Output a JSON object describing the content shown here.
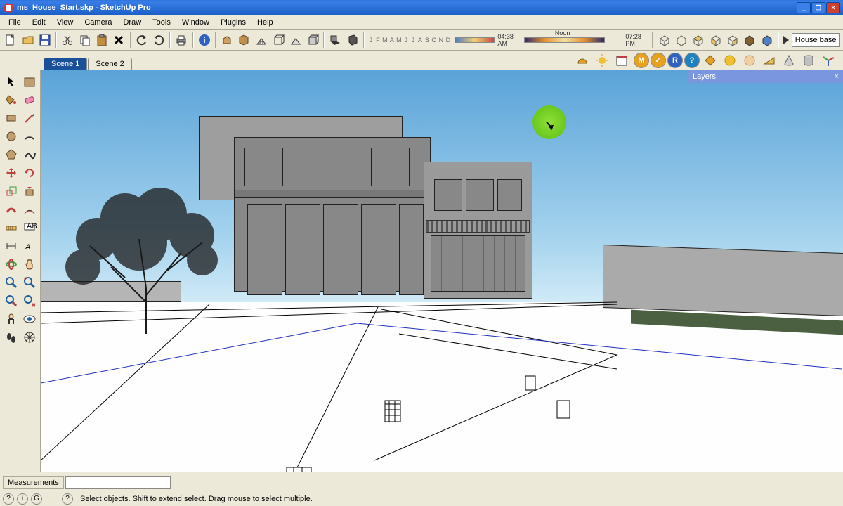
{
  "title": "ms_House_Start.skp - SketchUp Pro",
  "window_buttons": {
    "min": "_",
    "max": "❐",
    "close": "×"
  },
  "menu": [
    "File",
    "Edit",
    "View",
    "Camera",
    "Draw",
    "Tools",
    "Window",
    "Plugins",
    "Help"
  ],
  "main_toolbar_icons": [
    "new",
    "open",
    "save",
    "cut",
    "copy",
    "paste",
    "delete",
    "undo",
    "redo",
    "print",
    "info",
    "group",
    "component",
    "house-sm",
    "box-sm",
    "box-shaded",
    "box-wire",
    "cube-shadow",
    "cube-solid"
  ],
  "shadow": {
    "months": [
      "J",
      "F",
      "M",
      "A",
      "M",
      "J",
      "J",
      "A",
      "S",
      "O",
      "N",
      "D"
    ],
    "time_left": "04:38 AM",
    "time_mid": "Noon",
    "time_right": "07:28 PM"
  },
  "iso_icons": [
    "iso-1",
    "iso-2",
    "iso-3",
    "iso-4",
    "iso-5",
    "iso-6",
    "iso-7"
  ],
  "layer_label": "House base",
  "strip2_icons_left": [
    "dome",
    "globe",
    "calendar"
  ],
  "strip2_round": [
    {
      "t": "M",
      "bg": "#e8a020"
    },
    {
      "t": "✓",
      "bg": "#e8a020"
    },
    {
      "t": "R",
      "bg": "#3060c0"
    },
    {
      "t": "?",
      "bg": "#2080c0"
    }
  ],
  "strip2_icons_right": [
    "diamond",
    "sphere-y",
    "sphere-r",
    "wedge",
    "cone",
    "cylinder",
    "axes"
  ],
  "left_tools": [
    "select",
    "materials",
    "paint",
    "eraser",
    "rect",
    "line",
    "circle",
    "arc",
    "poly",
    "freehand",
    "move",
    "rotate",
    "scale",
    "pushpull",
    "offset",
    "follow",
    "tape",
    "text",
    "dim",
    "protractor",
    "pan",
    "orbit",
    "zoom",
    "zoom-ext",
    "look",
    "walk",
    "section",
    "axes2",
    "position",
    "shadows"
  ],
  "scenes": [
    {
      "label": "Scene 1",
      "active": true
    },
    {
      "label": "Scene 2",
      "active": false
    }
  ],
  "layers_title": "Layers",
  "measurements": "Measurements",
  "status_icons": [
    "?",
    "i",
    "G"
  ],
  "status_help": "?",
  "status_text": "Select objects. Shift to extend select. Drag mouse to select multiple."
}
